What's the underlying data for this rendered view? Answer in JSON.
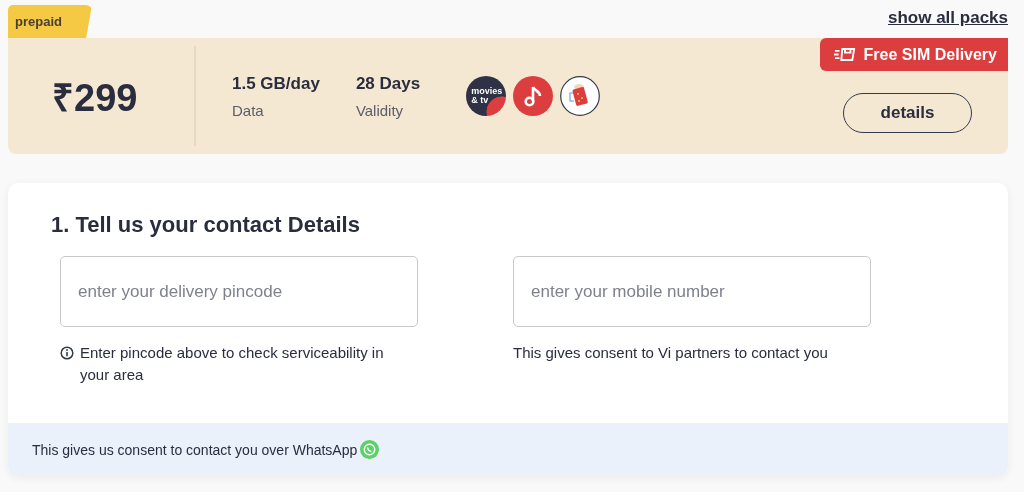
{
  "plan_type_tab": "prepaid",
  "show_all_link": "show all packs",
  "plan": {
    "price": "₹299",
    "specs": [
      {
        "value": "1.5 GB/day",
        "label": "Data"
      },
      {
        "value": "28 Days",
        "label": "Validity"
      }
    ],
    "benefits": [
      {
        "kind": "movies",
        "label": "movies & tv"
      },
      {
        "kind": "music"
      },
      {
        "kind": "drink"
      }
    ],
    "delivery_badge": "Free SIM Delivery",
    "details_button": "details"
  },
  "contact_form": {
    "heading": "1. Tell us your contact Details",
    "fields": [
      {
        "placeholder": "enter your delivery pincode",
        "note": "Enter pincode above to check serviceability in your area",
        "note_icon": true
      },
      {
        "placeholder": "enter your mobile number",
        "note": "This gives consent to Vi partners to contact you",
        "note_icon": false
      }
    ],
    "whatsapp_consent": "This gives us consent to contact you over WhatsApp"
  }
}
